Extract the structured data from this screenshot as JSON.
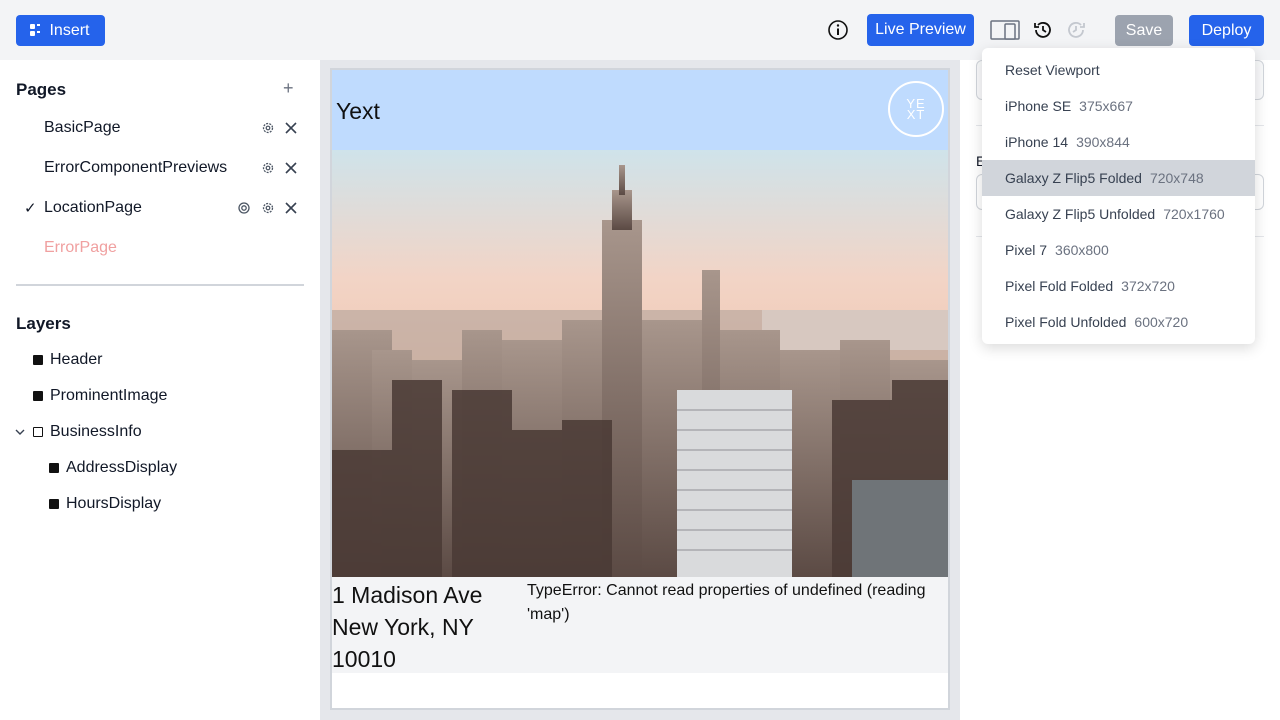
{
  "toolbar": {
    "insert_label": "Insert",
    "live_preview_label": "Live Preview",
    "save_label": "Save",
    "deploy_label": "Deploy"
  },
  "pages": {
    "title": "Pages",
    "items": [
      {
        "label": "BasicPage",
        "selected": false
      },
      {
        "label": "ErrorComponentPreviews",
        "selected": false
      },
      {
        "label": "LocationPage",
        "selected": true
      },
      {
        "label": "ErrorPage",
        "selected": false,
        "error": true
      }
    ]
  },
  "layers": {
    "title": "Layers",
    "items": [
      {
        "label": "Header"
      },
      {
        "label": "ProminentImage"
      },
      {
        "label": "BusinessInfo"
      },
      {
        "label": "AddressDisplay"
      },
      {
        "label": "HoursDisplay"
      }
    ]
  },
  "preview": {
    "brand": "Yext",
    "logo_line1": "YE",
    "logo_line2": "XT",
    "address_line1": "1 Madison Ave",
    "address_line2": "New York, NY",
    "address_line3": "10010",
    "error_text": "TypeError: Cannot read properties of undefined (reading 'map')"
  },
  "right_panel": {
    "label_initial": "E"
  },
  "viewport_menu": {
    "reset_label": "Reset Viewport",
    "items": [
      {
        "name": "iPhone SE",
        "size": "375x667"
      },
      {
        "name": "iPhone 14",
        "size": "390x844"
      },
      {
        "name": "Galaxy Z Flip5 Folded",
        "size": "720x748",
        "active": true
      },
      {
        "name": "Galaxy Z Flip5 Unfolded",
        "size": "720x1760"
      },
      {
        "name": "Pixel 7",
        "size": "360x800"
      },
      {
        "name": "Pixel Fold Folded",
        "size": "372x720"
      },
      {
        "name": "Pixel Fold Unfolded",
        "size": "600x720"
      }
    ]
  },
  "colors": {
    "accent": "#2563eb",
    "error_text": "#f0a0a0",
    "header_bg": "#bfdbfe"
  }
}
